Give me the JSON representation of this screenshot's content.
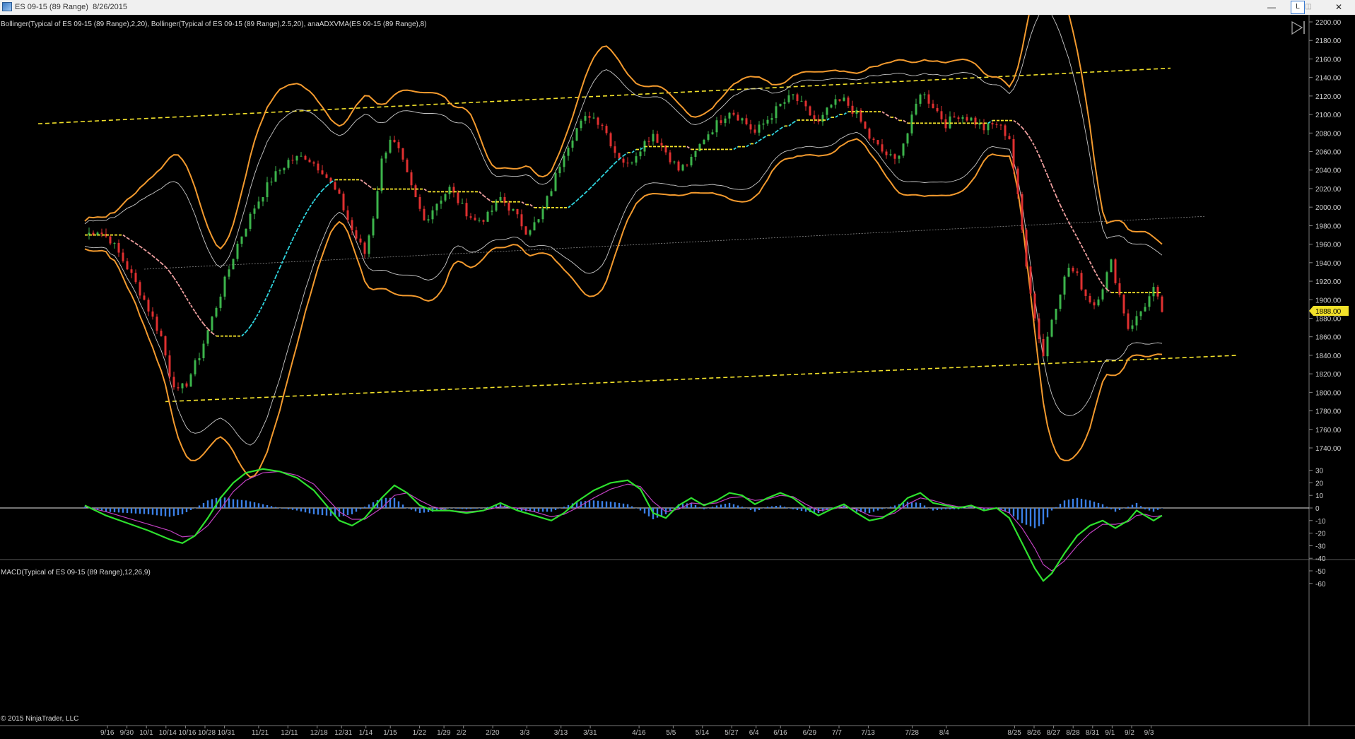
{
  "window": {
    "title": "ES 09-15 (89 Range)  8/26/2015",
    "min_label": "—",
    "mid_label": "L",
    "max_label": "◫",
    "close_label": "✕"
  },
  "panels": {
    "price_label": "Bollinger(Typical of ES 09-15 (89 Range),2,20), Bollinger(Typical of ES 09-15 (89 Range),2.5,20), anaADXVMA(ES 09-15 (89 Range),8)",
    "macd_label": "MACD(Typical of ES 09-15 (89 Range),12,26,9)",
    "copyright": "© 2015 NinjaTrader, LLC",
    "current_price": "1888.00"
  },
  "colors": {
    "background": "#000000",
    "bull_candle": "#3cb44b",
    "bear_candle": "#e03030",
    "outer_band": "#f39a2e",
    "inner_band": "#c8c8c8",
    "trend_line": "#f2e12a",
    "adxvma_up": "#2fd6e0",
    "adxvma_flat": "#f2e12a",
    "adxvma_down": "#f0a0a0",
    "macd_line": "#2ee02e",
    "signal_line": "#c040c0",
    "histogram": "#3a7fe6",
    "price_tag": "#f2e12a"
  },
  "chart_data": [
    {
      "type": "line",
      "panel": "price",
      "ylim": [
        1730,
        2205
      ],
      "y_ticks": [
        2200,
        2180,
        2160,
        2140,
        2120,
        2100,
        2080,
        2060,
        2040,
        2020,
        2000,
        1980,
        1960,
        1940,
        1920,
        1900,
        1880,
        1860,
        1840,
        1820,
        1800,
        1780,
        1760,
        1740
      ],
      "y_tick_labels": [
        "2200.00",
        "2180.00",
        "2160.00",
        "2140.00",
        "2120.00",
        "2100.00",
        "2080.00",
        "2060.00",
        "2040.00",
        "2020.00",
        "2000.00",
        "1980.00",
        "1960.00",
        "1940.00",
        "1920.00",
        "1900.00",
        "1880.00",
        "1860.00",
        "1840.00",
        "1820.00",
        "1800.00",
        "1780.00",
        "1760.00",
        "1740.00"
      ],
      "x_labels": [
        "9/16",
        "9/30",
        "10/1",
        "10/14",
        "10/16",
        "10/28",
        "10/31",
        "11/21",
        "12/11",
        "12/18",
        "12/31",
        "1/14",
        "1/15",
        "1/22",
        "1/29",
        "2/2",
        "2/20",
        "3/3",
        "3/13",
        "3/31",
        "4/16",
        "5/5",
        "5/14",
        "5/27",
        "6/4",
        "6/16",
        "6/29",
        "7/7",
        "7/13",
        "7/28",
        "8/4",
        "8/25",
        "8/26",
        "8/27",
        "8/28",
        "8/31",
        "9/1",
        "9/2",
        "9/3"
      ],
      "x_label_slot": [
        0.0,
        0.4,
        0.8,
        1.2,
        1.6,
        2.0,
        2.4,
        3.1,
        3.7,
        4.3,
        4.8,
        5.3,
        5.8,
        6.4,
        6.9,
        7.3,
        7.9,
        8.6,
        9.3,
        9.9,
        10.9,
        11.6,
        12.2,
        12.8,
        13.3,
        13.8,
        14.4,
        15.0,
        15.6,
        16.5,
        17.2,
        18.6,
        19.0,
        19.4,
        19.8,
        20.2,
        20.6,
        21.0,
        21.4
      ],
      "price_points": [
        [
          0,
          1970
        ],
        [
          3,
          1975
        ],
        [
          6,
          1965
        ],
        [
          10,
          1935
        ],
        [
          14,
          1900
        ],
        [
          18,
          1860
        ],
        [
          20,
          1820
        ],
        [
          22,
          1800
        ],
        [
          24,
          1810
        ],
        [
          27,
          1840
        ],
        [
          30,
          1880
        ],
        [
          33,
          1920
        ],
        [
          36,
          1960
        ],
        [
          40,
          2000
        ],
        [
          44,
          2030
        ],
        [
          48,
          2050
        ],
        [
          52,
          2055
        ],
        [
          56,
          2040
        ],
        [
          60,
          2010
        ],
        [
          63,
          1975
        ],
        [
          66,
          1950
        ],
        [
          68,
          1990
        ],
        [
          70,
          2050
        ],
        [
          72,
          2075
        ],
        [
          74,
          2060
        ],
        [
          77,
          2020
        ],
        [
          80,
          1985
        ],
        [
          83,
          2005
        ],
        [
          86,
          2020
        ],
        [
          89,
          2000
        ],
        [
          92,
          1985
        ],
        [
          95,
          1990
        ],
        [
          98,
          2010
        ],
        [
          101,
          1995
        ],
        [
          104,
          1975
        ],
        [
          107,
          1985
        ],
        [
          110,
          2020
        ],
        [
          113,
          2060
        ],
        [
          116,
          2085
        ],
        [
          119,
          2100
        ],
        [
          122,
          2090
        ],
        [
          125,
          2060
        ],
        [
          128,
          2045
        ],
        [
          131,
          2065
        ],
        [
          134,
          2080
        ],
        [
          137,
          2060
        ],
        [
          140,
          2040
        ],
        [
          143,
          2050
        ],
        [
          146,
          2075
        ],
        [
          149,
          2090
        ],
        [
          152,
          2105
        ],
        [
          155,
          2095
        ],
        [
          158,
          2080
        ],
        [
          161,
          2095
        ],
        [
          164,
          2110
        ],
        [
          167,
          2120
        ],
        [
          170,
          2105
        ],
        [
          173,
          2090
        ],
        [
          176,
          2110
        ],
        [
          179,
          2115
        ],
        [
          182,
          2100
        ],
        [
          185,
          2075
        ],
        [
          188,
          2060
        ],
        [
          191,
          2050
        ],
        [
          194,
          2080
        ],
        [
          197,
          2125
        ],
        [
          200,
          2110
        ],
        [
          203,
          2090
        ],
        [
          206,
          2100
        ],
        [
          209,
          2095
        ],
        [
          212,
          2085
        ],
        [
          215,
          2090
        ],
        [
          218,
          2075
        ],
        [
          220,
          2010
        ],
        [
          222,
          1940
        ],
        [
          224,
          1880
        ],
        [
          226,
          1840
        ],
        [
          228,
          1880
        ],
        [
          230,
          1910
        ],
        [
          232,
          1935
        ],
        [
          234,
          1925
        ],
        [
          236,
          1905
        ],
        [
          238,
          1895
        ],
        [
          240,
          1915
        ],
        [
          242,
          1940
        ],
        [
          244,
          1905
        ],
        [
          246,
          1870
        ],
        [
          248,
          1880
        ],
        [
          250,
          1895
        ],
        [
          252,
          1910
        ],
        [
          254,
          1888
        ]
      ],
      "trend_lines": [
        {
          "name": "upper",
          "from": [
            -11,
            2090
          ],
          "to": [
            256,
            2150
          ]
        },
        {
          "name": "lower",
          "from": [
            19,
            1790
          ],
          "to": [
            272,
            1840
          ]
        },
        {
          "name": "mid",
          "from": [
            14,
            1933
          ],
          "to": [
            264,
            1990
          ]
        }
      ]
    },
    {
      "type": "line",
      "panel": "macd",
      "ylim": [
        -62,
        36
      ],
      "y_ticks": [
        30,
        20,
        10,
        0,
        -10,
        -20,
        -30,
        -40,
        -50,
        -60
      ],
      "macd": [
        [
          0,
          2
        ],
        [
          5,
          -6
        ],
        [
          10,
          -12
        ],
        [
          15,
          -18
        ],
        [
          20,
          -25
        ],
        [
          23,
          -28
        ],
        [
          26,
          -22
        ],
        [
          29,
          -8
        ],
        [
          32,
          8
        ],
        [
          35,
          20
        ],
        [
          38,
          28
        ],
        [
          42,
          31
        ],
        [
          46,
          29
        ],
        [
          50,
          24
        ],
        [
          54,
          14
        ],
        [
          57,
          2
        ],
        [
          60,
          -10
        ],
        [
          63,
          -14
        ],
        [
          66,
          -8
        ],
        [
          70,
          8
        ],
        [
          73,
          18
        ],
        [
          76,
          12
        ],
        [
          79,
          2
        ],
        [
          82,
          -2
        ],
        [
          86,
          -2
        ],
        [
          90,
          -4
        ],
        [
          94,
          -2
        ],
        [
          98,
          4
        ],
        [
          102,
          -2
        ],
        [
          106,
          -6
        ],
        [
          110,
          -10
        ],
        [
          113,
          -4
        ],
        [
          116,
          5
        ],
        [
          120,
          14
        ],
        [
          124,
          20
        ],
        [
          128,
          22
        ],
        [
          131,
          15
        ],
        [
          134,
          -4
        ],
        [
          137,
          -8
        ],
        [
          140,
          2
        ],
        [
          143,
          8
        ],
        [
          146,
          2
        ],
        [
          149,
          6
        ],
        [
          152,
          12
        ],
        [
          155,
          10
        ],
        [
          158,
          3
        ],
        [
          161,
          8
        ],
        [
          164,
          12
        ],
        [
          167,
          8
        ],
        [
          170,
          0
        ],
        [
          173,
          -6
        ],
        [
          176,
          -1
        ],
        [
          179,
          3
        ],
        [
          182,
          -4
        ],
        [
          185,
          -10
        ],
        [
          188,
          -8
        ],
        [
          191,
          -2
        ],
        [
          194,
          8
        ],
        [
          197,
          12
        ],
        [
          200,
          4
        ],
        [
          203,
          2
        ],
        [
          206,
          0
        ],
        [
          209,
          2
        ],
        [
          212,
          -2
        ],
        [
          215,
          0
        ],
        [
          218,
          -8
        ],
        [
          221,
          -28
        ],
        [
          224,
          -48
        ],
        [
          226,
          -58
        ],
        [
          228,
          -52
        ],
        [
          231,
          -36
        ],
        [
          234,
          -22
        ],
        [
          237,
          -14
        ],
        [
          240,
          -10
        ],
        [
          243,
          -16
        ],
        [
          246,
          -10
        ],
        [
          248,
          -2
        ],
        [
          250,
          -6
        ],
        [
          252,
          -10
        ],
        [
          254,
          -6
        ]
      ],
      "signal": [
        [
          0,
          1
        ],
        [
          5,
          -3
        ],
        [
          10,
          -8
        ],
        [
          15,
          -13
        ],
        [
          20,
          -18
        ],
        [
          23,
          -23
        ],
        [
          26,
          -22
        ],
        [
          29,
          -14
        ],
        [
          32,
          -1
        ],
        [
          35,
          13
        ],
        [
          38,
          22
        ],
        [
          42,
          28
        ],
        [
          46,
          29
        ],
        [
          50,
          26
        ],
        [
          54,
          19
        ],
        [
          57,
          8
        ],
        [
          60,
          -3
        ],
        [
          63,
          -9
        ],
        [
          66,
          -9
        ],
        [
          70,
          0
        ],
        [
          73,
          10
        ],
        [
          76,
          12
        ],
        [
          79,
          6
        ],
        [
          82,
          1
        ],
        [
          86,
          -2
        ],
        [
          90,
          -3
        ],
        [
          94,
          -2
        ],
        [
          98,
          1
        ],
        [
          102,
          0
        ],
        [
          106,
          -3
        ],
        [
          110,
          -7
        ],
        [
          113,
          -5
        ],
        [
          116,
          0
        ],
        [
          120,
          8
        ],
        [
          124,
          15
        ],
        [
          128,
          19
        ],
        [
          131,
          17
        ],
        [
          134,
          5
        ],
        [
          137,
          -3
        ],
        [
          140,
          -1
        ],
        [
          143,
          4
        ],
        [
          146,
          3
        ],
        [
          149,
          4
        ],
        [
          152,
          8
        ],
        [
          155,
          9
        ],
        [
          158,
          6
        ],
        [
          161,
          7
        ],
        [
          164,
          10
        ],
        [
          167,
          9
        ],
        [
          170,
          3
        ],
        [
          173,
          -2
        ],
        [
          176,
          -1
        ],
        [
          179,
          1
        ],
        [
          182,
          -1
        ],
        [
          185,
          -6
        ],
        [
          188,
          -7
        ],
        [
          191,
          -4
        ],
        [
          194,
          3
        ],
        [
          197,
          8
        ],
        [
          200,
          6
        ],
        [
          203,
          3
        ],
        [
          206,
          1
        ],
        [
          209,
          1
        ],
        [
          212,
          0
        ],
        [
          215,
          0
        ],
        [
          218,
          -4
        ],
        [
          221,
          -16
        ],
        [
          224,
          -32
        ],
        [
          226,
          -45
        ],
        [
          228,
          -50
        ],
        [
          231,
          -42
        ],
        [
          234,
          -30
        ],
        [
          237,
          -20
        ],
        [
          240,
          -13
        ],
        [
          243,
          -13
        ],
        [
          246,
          -11
        ],
        [
          248,
          -6
        ],
        [
          250,
          -5
        ],
        [
          252,
          -7
        ],
        [
          254,
          -6
        ]
      ]
    }
  ]
}
